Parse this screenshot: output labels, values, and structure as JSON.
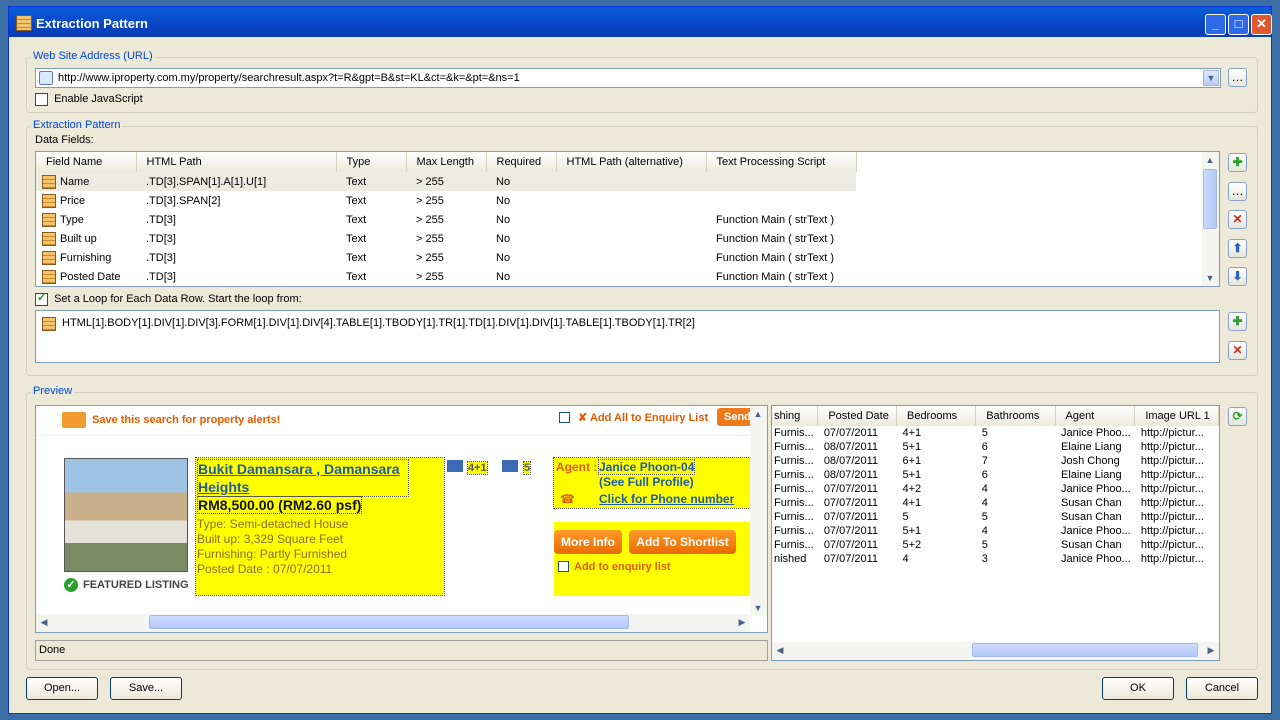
{
  "window": {
    "title": "Extraction Pattern"
  },
  "url_group": {
    "label": "Web Site Address (URL)",
    "url": "http://www.iproperty.com.my/property/searchresult.aspx?t=R&gpt=B&st=KL&ct=&k=&pt=&ns=1",
    "enable_js": "Enable JavaScript"
  },
  "pattern_group": {
    "label": "Extraction Pattern",
    "data_fields_label": "Data Fields:",
    "columns": [
      "Field Name",
      "HTML Path",
      "Type",
      "Max Length",
      "Required",
      "HTML Path (alternative)",
      "Text Processing Script"
    ],
    "rows": [
      {
        "name": "Name",
        "path": ".TD[3].SPAN[1].A[1].U[1]",
        "type": "Text",
        "max": "> 255",
        "req": "No",
        "alt": "",
        "script": ""
      },
      {
        "name": "Price",
        "path": ".TD[3].SPAN[2]",
        "type": "Text",
        "max": "> 255",
        "req": "No",
        "alt": "",
        "script": ""
      },
      {
        "name": "Type",
        "path": ".TD[3]",
        "type": "Text",
        "max": "> 255",
        "req": "No",
        "alt": "",
        "script": "Function Main ( strText )"
      },
      {
        "name": "Built up",
        "path": ".TD[3]",
        "type": "Text",
        "max": "> 255",
        "req": "No",
        "alt": "",
        "script": "Function Main ( strText )"
      },
      {
        "name": "Furnishing",
        "path": ".TD[3]",
        "type": "Text",
        "max": "> 255",
        "req": "No",
        "alt": "",
        "script": "Function Main ( strText )"
      },
      {
        "name": "Posted Date",
        "path": ".TD[3]",
        "type": "Text",
        "max": "> 255",
        "req": "No",
        "alt": "",
        "script": "Function Main ( strText )"
      }
    ],
    "loop_label": "Set a Loop for Each Data Row. Start the loop from:",
    "loop_path": "HTML[1].BODY[1].DIV[1].DIV[3].FORM[1].DIV[1].DIV[4].TABLE[1].TBODY[1].TR[1].TD[1].DIV[1].DIV[1].TABLE[1].TBODY[1].TR[2]"
  },
  "preview": {
    "label": "Preview",
    "save_alert": "Save this search for property alerts!",
    "add_all": "Add All to Enquiry List",
    "send": "Send",
    "title": "Bukit Damansara , Damansara Heights",
    "price": "RM8,500.00 (RM2.60 psf)",
    "type": "Type: Semi-detached House",
    "built": "Built up: 3,329 Square Feet",
    "furnish": "Furnishing: Partly Furnished",
    "posted": "Posted Date : 07/07/2011",
    "featured": "FEATURED LISTING",
    "beds": "4+1",
    "baths": "5",
    "agent_label": "Agent :",
    "agent": "Janice Phoon-04",
    "profile": "(See Full Profile)",
    "phone": "Click for Phone number",
    "more": "More Info",
    "shortlist": "Add To Shortlist",
    "enquiry": "Add to enquiry list",
    "status": "Done"
  },
  "results": {
    "columns": [
      "shing",
      "Posted Date",
      "Bedrooms",
      "Bathrooms",
      "Agent",
      "Image URL 1"
    ],
    "rows": [
      [
        "Furnis...",
        "07/07/2011",
        "4+1",
        "5",
        "Janice Phoo...",
        "http://pictur..."
      ],
      [
        "Furnis...",
        "08/07/2011",
        "5+1",
        "6",
        "Elaine Liang",
        "http://pictur..."
      ],
      [
        "Furnis...",
        "08/07/2011",
        "6+1",
        "7",
        "Josh Chong",
        "http://pictur..."
      ],
      [
        "Furnis...",
        "08/07/2011",
        "5+1",
        "6",
        "Elaine Liang",
        "http://pictur..."
      ],
      [
        "Furnis...",
        "07/07/2011",
        "4+2",
        "4",
        "Janice Phoo...",
        "http://pictur..."
      ],
      [
        "Furnis...",
        "07/07/2011",
        "4+1",
        "4",
        "Susan Chan",
        "http://pictur..."
      ],
      [
        "Furnis...",
        "07/07/2011",
        "5",
        "5",
        "Susan Chan",
        "http://pictur..."
      ],
      [
        "Furnis...",
        "07/07/2011",
        "5+1",
        "4",
        "Janice Phoo...",
        "http://pictur..."
      ],
      [
        "Furnis...",
        "07/07/2011",
        "5+2",
        "5",
        "Susan Chan",
        "http://pictur..."
      ],
      [
        "nished",
        "07/07/2011",
        "4",
        "3",
        "Janice Phoo...",
        "http://pictur..."
      ]
    ]
  },
  "buttons": {
    "open": "Open...",
    "save": "Save...",
    "ok": "OK",
    "cancel": "Cancel"
  }
}
